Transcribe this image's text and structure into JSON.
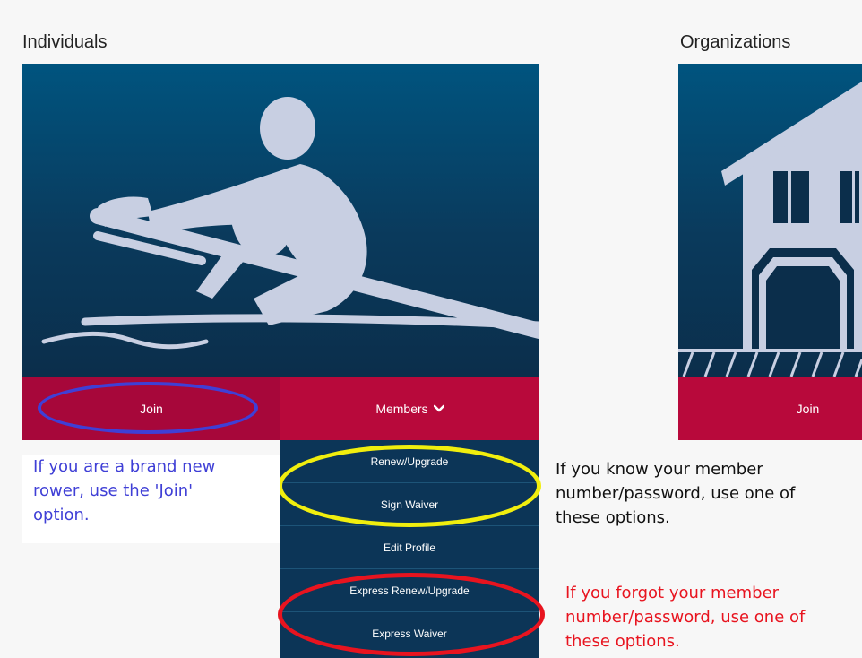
{
  "sections": {
    "individuals_title": "Individuals",
    "organizations_title": "Organizations"
  },
  "buttons": {
    "join_individual": "Join",
    "members": "Members",
    "join_organization": "Join"
  },
  "members_menu": {
    "items": [
      "Renew/Upgrade",
      "Sign Waiver",
      "Edit Profile",
      "Express Renew/Upgrade",
      "Express Waiver"
    ]
  },
  "annotations": {
    "join_note": "If you are a brand new rower, use the 'Join' option.",
    "known_note": "If you know your member number/password, use one of these options.",
    "forgot_note": "If you forgot your member number/password, use one of these options."
  },
  "colors": {
    "panel_top": "#00547f",
    "panel_bottom": "#0b2e4b",
    "button_red": "#b8093b",
    "dropdown_bg": "#0c3557",
    "blue_annotation": "#3f3fd6",
    "yellow_annotation": "#f1ee0e",
    "red_annotation": "#e8141f"
  },
  "icons": {
    "individual_panel": "rower-icon",
    "organization_panel": "boathouse-icon",
    "members_chevron": "chevron-down-icon"
  }
}
